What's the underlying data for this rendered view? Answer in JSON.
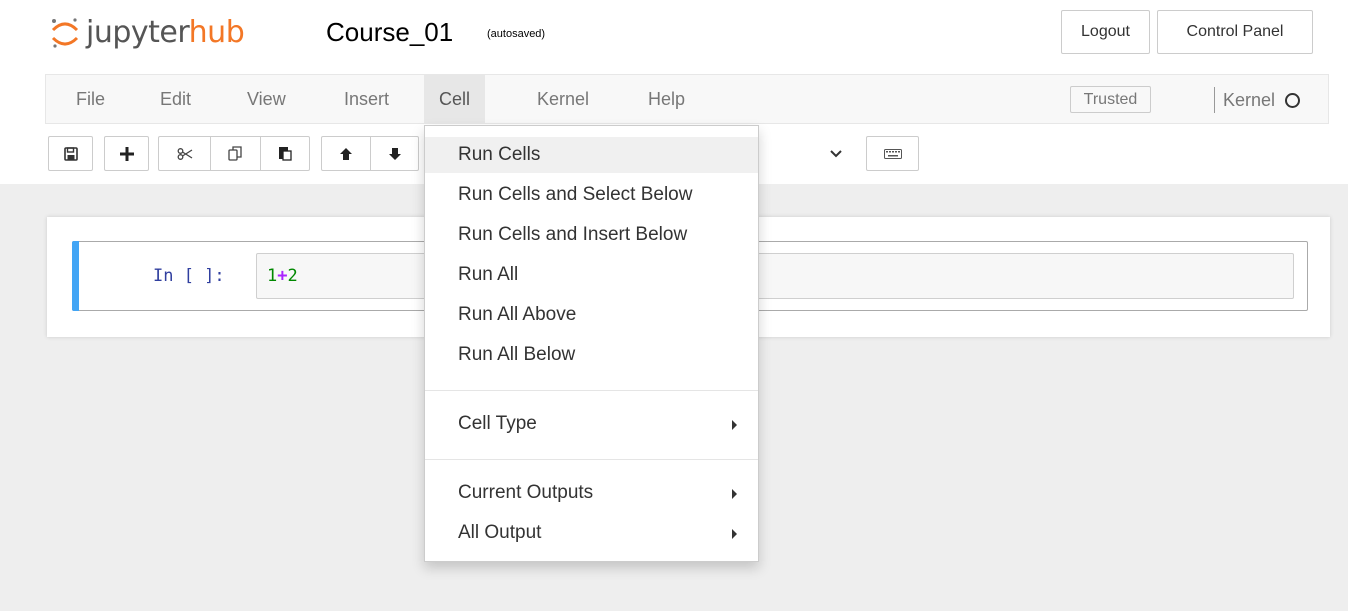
{
  "header": {
    "logo_text_part1": "jupyter",
    "logo_text_part2": "hub",
    "notebook_name": "Course_01",
    "autosave_status": "(autosaved)",
    "logout_label": "Logout",
    "control_panel_label": "Control Panel"
  },
  "menubar": {
    "items": [
      {
        "label": "File"
      },
      {
        "label": "Edit"
      },
      {
        "label": "View"
      },
      {
        "label": "Insert"
      },
      {
        "label": "Cell"
      },
      {
        "label": "Kernel"
      },
      {
        "label": "Help"
      }
    ],
    "active_menu": "Cell",
    "trusted_label": "Trusted",
    "kernel_label": "Kernel"
  },
  "toolbar": {
    "icons": [
      "save-icon",
      "plus-icon",
      "scissors-icon",
      "copy-icon",
      "paste-icon",
      "arrow-up-icon",
      "arrow-down-icon",
      "keyboard-icon"
    ],
    "celltype_chevron": "chevron-down-icon"
  },
  "cell": {
    "prompt": "In [ ]:",
    "code_num1": "1",
    "code_op": "+",
    "code_num2": "2"
  },
  "cell_menu": {
    "items": [
      {
        "label": "Run Cells"
      },
      {
        "label": "Run Cells and Select Below"
      },
      {
        "label": "Run Cells and Insert Below"
      },
      {
        "label": "Run All"
      },
      {
        "label": "Run All Above"
      },
      {
        "label": "Run All Below"
      },
      {
        "label": "Cell Type"
      },
      {
        "label": "Current Outputs"
      },
      {
        "label": "All Output"
      }
    ]
  },
  "colors": {
    "hub_orange": "#f37726",
    "cell_selected_bar": "#42a5f5",
    "prompt_blue": "#303f9f"
  }
}
